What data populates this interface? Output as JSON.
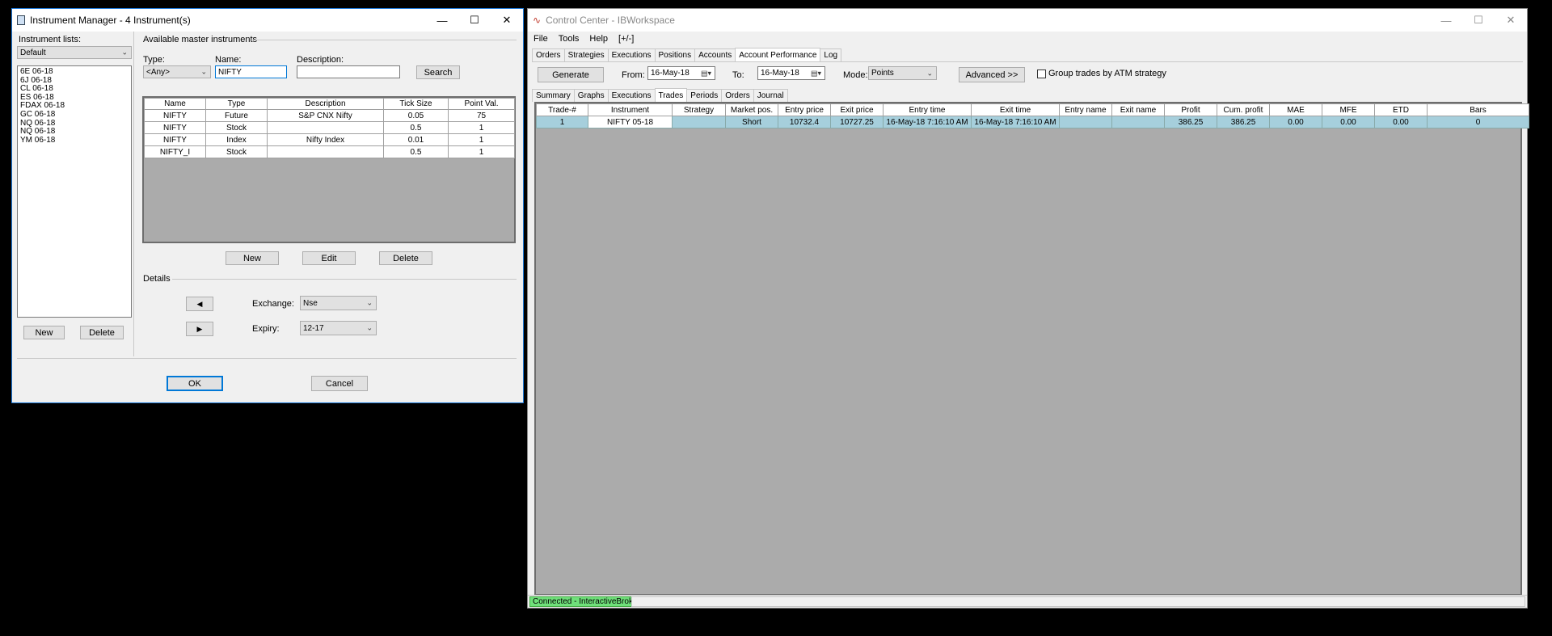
{
  "instrument_manager": {
    "title": "Instrument Manager - 4 Instrument(s)",
    "instrument_lists_label": "Instrument lists:",
    "list_selected": "Default",
    "list_items": [
      "6E 06-18",
      "6J 06-18",
      "CL 06-18",
      "ES 06-18",
      "FDAX 06-18",
      "GC 06-18",
      "NQ 06-18",
      "NQ 06-18",
      "YM 06-18"
    ],
    "list_new": "New",
    "list_delete": "Delete",
    "available_label": "Available master instruments",
    "type_label": "Type:",
    "type_value": "<Any>",
    "name_label": "Name:",
    "name_value": "NIFTY",
    "description_label": "Description:",
    "description_value": "",
    "search": "Search",
    "columns": [
      "Name",
      "Type",
      "Description",
      "Tick Size",
      "Point Val."
    ],
    "rows": [
      [
        "NIFTY",
        "Future",
        "S&P CNX Nifty",
        "0.05",
        "75"
      ],
      [
        "NIFTY",
        "Stock",
        "",
        "0.5",
        "1"
      ],
      [
        "NIFTY",
        "Index",
        "Nifty Index",
        "0.01",
        "1"
      ],
      [
        "NIFTY_I",
        "Stock",
        "",
        "0.5",
        "1"
      ]
    ],
    "grid_new": "New",
    "grid_edit": "Edit",
    "grid_delete": "Delete",
    "details_label": "Details",
    "exchange_label": "Exchange:",
    "exchange_value": "Nse",
    "expiry_label": "Expiry:",
    "expiry_value": "12-17",
    "ok": "OK",
    "cancel": "Cancel"
  },
  "control_center": {
    "title": "Control Center - IBWorkspace",
    "menu": [
      "File",
      "Tools",
      "Help",
      "[+/-]"
    ],
    "tabs": [
      "Orders",
      "Strategies",
      "Executions",
      "Positions",
      "Accounts",
      "Account Performance",
      "Log"
    ],
    "active_tab": 5,
    "generate": "Generate",
    "from_label": "From:",
    "from_value": "16-May-18",
    "to_label": "To:",
    "to_value": "16-May-18",
    "mode_label": "Mode:",
    "mode_value": "Points",
    "advanced": "Advanced >>",
    "group_trades": "Group trades by ATM strategy",
    "subtabs": [
      "Summary",
      "Graphs",
      "Executions",
      "Trades",
      "Periods",
      "Orders",
      "Journal"
    ],
    "active_subtab": 3,
    "columns": [
      "Trade-#",
      "Instrument",
      "Strategy",
      "Market pos.",
      "Entry price",
      "Exit price",
      "Entry time",
      "Exit time",
      "Entry name",
      "Exit name",
      "Profit",
      "Cum. profit",
      "MAE",
      "MFE",
      "ETD",
      "Bars"
    ],
    "rows": [
      [
        "1",
        "NIFTY 05-18",
        "",
        "Short",
        "10732.4",
        "10727.25",
        "16-May-18 7:16:10 AM",
        "16-May-18 7:16:10 AM",
        "",
        "",
        "386.25",
        "386.25",
        "0.00",
        "0.00",
        "0.00",
        "0"
      ]
    ],
    "status": "Connected - InteractiveBrokers"
  }
}
